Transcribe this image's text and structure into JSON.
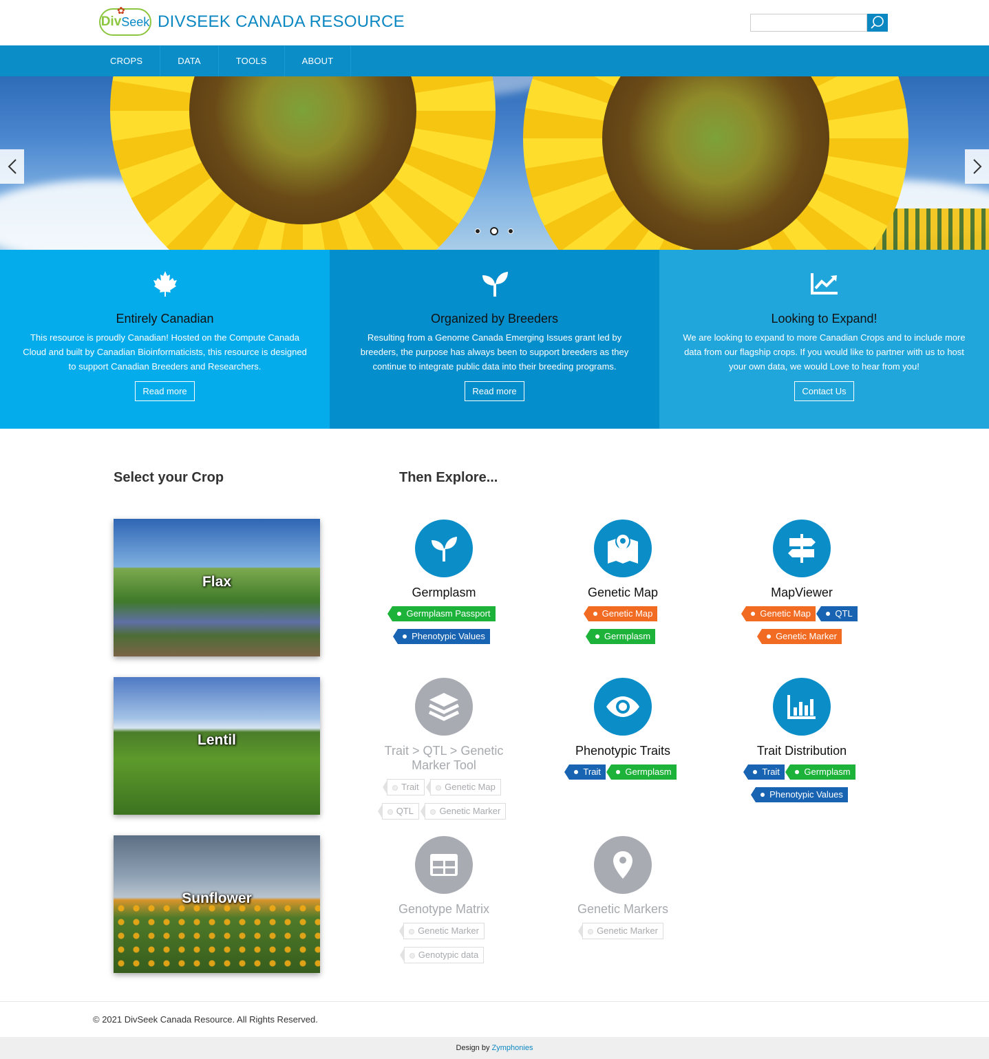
{
  "header": {
    "logo_div": "Div",
    "logo_seek": "Seek",
    "title": "DIVSEEK CANADA RESOURCE",
    "search_placeholder": ""
  },
  "nav": {
    "items": [
      "CROPS",
      "DATA",
      "TOOLS",
      "ABOUT"
    ]
  },
  "carousel": {
    "slides": 3,
    "active_slide": 2
  },
  "features": [
    {
      "icon": "maple-leaf-icon",
      "title": "Entirely Canadian",
      "text": "This resource is proudly Canadian! Hosted on the Compute Canada Cloud and built by Canadian Bioinformaticists, this resource is designed to support Canadian Breeders and Researchers.",
      "button": "Read more",
      "color": "#04aceb"
    },
    {
      "icon": "seedling-icon",
      "title": "Organized by Breeders",
      "text": "Resulting from a Genome Canada Emerging Issues grant led by breeders, the purpose has always been to support breeders as they continue to integrate public data into their breeding programs.",
      "button": "Read more",
      "color": "#048ecc"
    },
    {
      "icon": "chart-line-icon",
      "title": "Looking to Expand!",
      "text": "We are looking to expand to more Canadian Crops and to include more data from our flagship crops. If you would like to partner with us to host your own data, we would Love to hear from you!",
      "button": "Contact Us",
      "color": "#21a6dc"
    }
  ],
  "crops": {
    "title": "Select your Crop",
    "items": [
      "Flax",
      "Lentil",
      "Sunflower"
    ]
  },
  "explore": {
    "title": "Then Explore...",
    "tools": [
      {
        "name": "Germplasm",
        "icon": "seedling-icon",
        "enabled": true,
        "tags": [
          [
            "Germplasm Passport",
            "green"
          ],
          [
            "Phenotypic Values",
            "blue"
          ]
        ]
      },
      {
        "name": "Genetic Map",
        "icon": "map-marker-icon",
        "enabled": true,
        "tags": [
          [
            "Genetic Map",
            "orange"
          ],
          [
            "Germplasm",
            "green"
          ]
        ]
      },
      {
        "name": "MapViewer",
        "icon": "signpost-icon",
        "enabled": true,
        "tags": [
          [
            "Genetic Map",
            "orange"
          ],
          [
            "QTL",
            "blue"
          ],
          [
            "Genetic Marker",
            "orange"
          ]
        ]
      },
      {
        "name": "Trait > QTL > Genetic Marker Tool",
        "icon": "layers-icon",
        "enabled": false,
        "tags": [
          [
            "Trait",
            "grey"
          ],
          [
            "Genetic Map",
            "grey"
          ],
          [
            "QTL",
            "grey"
          ],
          [
            "Genetic Marker",
            "grey"
          ]
        ]
      },
      {
        "name": "Phenotypic Traits",
        "icon": "eye-icon",
        "enabled": true,
        "tags": [
          [
            "Trait",
            "blue"
          ],
          [
            "Germplasm",
            "green"
          ]
        ]
      },
      {
        "name": "Trait Distribution",
        "icon": "bar-chart-icon",
        "enabled": true,
        "tags": [
          [
            "Trait",
            "blue"
          ],
          [
            "Germplasm",
            "green"
          ],
          [
            "Phenotypic Values",
            "blue"
          ]
        ]
      },
      {
        "name": "Genotype Matrix",
        "icon": "table-icon",
        "enabled": false,
        "tags": [
          [
            "Genetic Marker",
            "grey"
          ],
          [
            "Genotypic data",
            "grey"
          ]
        ]
      },
      {
        "name": "Genetic Markers",
        "icon": "location-pin-icon",
        "enabled": false,
        "tags": [
          [
            "Genetic Marker",
            "grey"
          ]
        ]
      }
    ]
  },
  "footer": {
    "copyright": "© 2021 DivSeek Canada Resource. All Rights Reserved.",
    "design_prefix": "Design by ",
    "design_link": "Zymphonies"
  },
  "colors": {
    "brand_blue": "#0b8dc8",
    "tag_green": "#1db33a",
    "tag_blue": "#1863b2",
    "tag_orange": "#f26b23",
    "disabled_grey": "#a8acb2"
  }
}
